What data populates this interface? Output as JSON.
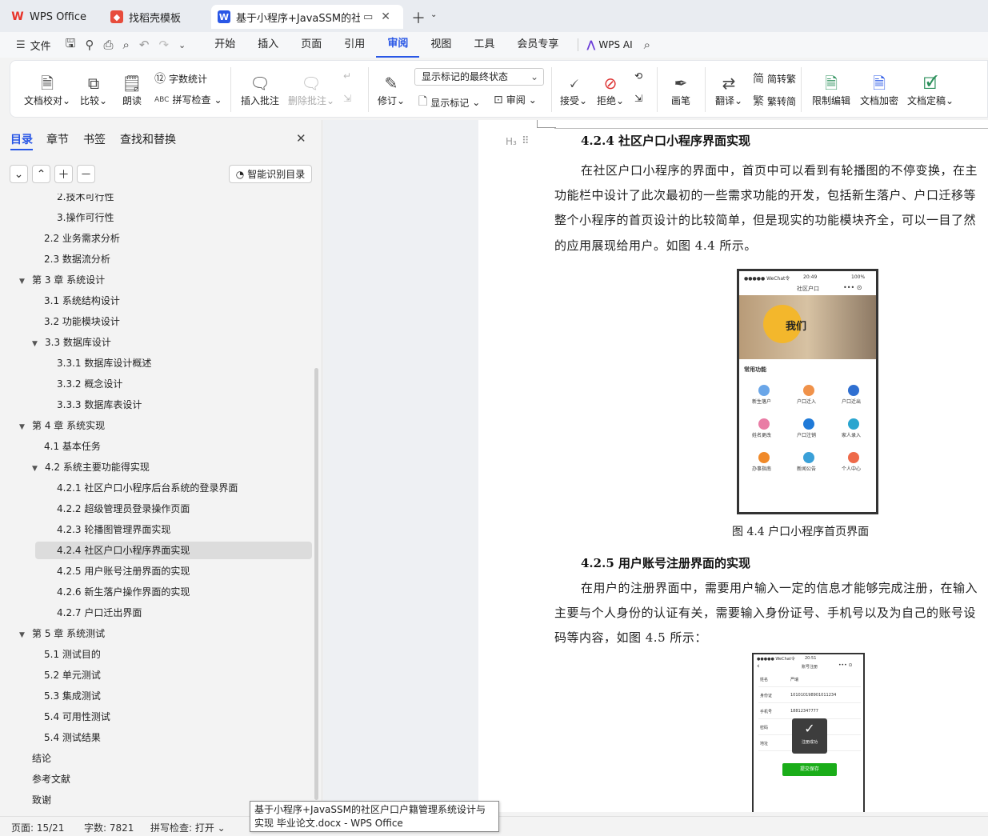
{
  "tabs": [
    {
      "label": "WPS Office",
      "icon": "wps-logo-icon"
    },
    {
      "label": "找稻壳模板",
      "icon": "docer-icon"
    },
    {
      "label": "基于小程序+JavaSSM的社区户",
      "icon": "word-doc-icon"
    }
  ],
  "menu": {
    "file": "文件",
    "items": [
      "开始",
      "插入",
      "页面",
      "引用",
      "审阅",
      "视图",
      "工具",
      "会员专享"
    ],
    "active": "审阅",
    "ai": "WPS AI"
  },
  "ribbon": {
    "doc_check": "文档校对",
    "compare": "比较",
    "read": "朗读",
    "word_count": "字数统计",
    "spell_check": "拼写检查",
    "insert_comment": "插入批注",
    "delete_comment": "删除批注",
    "revise": "修订",
    "markup_select": "显示标记的最终状态",
    "show_markup": "显示标记",
    "review": "审阅",
    "accept": "接受",
    "reject": "拒绝",
    "pen": "画笔",
    "translate": "翻译",
    "to_trad": "简转繁",
    "to_simp": "繁转简",
    "restrict": "限制编辑",
    "encrypt": "文档加密",
    "finalize": "文档定稿"
  },
  "sidebar": {
    "tabs": [
      "目录",
      "章节",
      "书签",
      "查找和替换"
    ],
    "smart_btn": "智能识别目录",
    "toc": [
      {
        "label": "2.技术可行性",
        "level": 3
      },
      {
        "label": "3.操作可行性",
        "level": 3
      },
      {
        "label": "2.2 业务需求分析",
        "level": 2
      },
      {
        "label": "2.3 数据流分析",
        "level": 2
      },
      {
        "label": "第 3 章  系统设计",
        "level": 1,
        "open": true
      },
      {
        "label": "3.1 系统结构设计",
        "level": 2
      },
      {
        "label": "3.2 功能模块设计",
        "level": 2
      },
      {
        "label": "3.3 数据库设计",
        "level": 2,
        "open": true
      },
      {
        "label": "3.3.1 数据库设计概述",
        "level": 3
      },
      {
        "label": "3.3.2 概念设计",
        "level": 3
      },
      {
        "label": "3.3.3 数据库表设计",
        "level": 3
      },
      {
        "label": "第 4 章   系统实现",
        "level": 1,
        "open": true
      },
      {
        "label": "4.1 基本任务",
        "level": 2
      },
      {
        "label": "4.2 系统主要功能得实现",
        "level": 2,
        "open": true
      },
      {
        "label": "4.2.1 社区户口小程序后台系统的登录界面",
        "level": 3
      },
      {
        "label": "4.2.2  超级管理员登录操作页面",
        "level": 3
      },
      {
        "label": "4.2.3 轮播图管理界面实现",
        "level": 3
      },
      {
        "label": "4.2.4 社区户口小程序界面实现",
        "level": 3,
        "selected": true
      },
      {
        "label": "4.2.5 用户账号注册界面的实现",
        "level": 3
      },
      {
        "label": "4.2.6 新生落户操作界面的实现",
        "level": 3
      },
      {
        "label": "4.2.7 户口迁出界面",
        "level": 3
      },
      {
        "label": "第 5 章   系统测试",
        "level": 1,
        "open": true
      },
      {
        "label": "5.1 测试目的",
        "level": 2
      },
      {
        "label": "5.2 单元测试",
        "level": 2
      },
      {
        "label": "5.3 集成测试",
        "level": 2
      },
      {
        "label": "5.4 可用性测试",
        "level": 2
      },
      {
        "label": "5.4 测试结果",
        "level": 2
      },
      {
        "label": "结论",
        "level": 1
      },
      {
        "label": "参考文献",
        "level": 1
      },
      {
        "label": "致谢",
        "level": 1
      }
    ]
  },
  "doc": {
    "heading_424": "4.2.4 社区户口小程序界面实现",
    "p1": [
      "在社区户口小程序的界面中，首页中可以看到有轮播图的不停变换，在主",
      "功能栏中设计了此次最初的一些需求功能的开发，包括新生落户、户口迁移等",
      "整个小程序的首页设计的比较简单，但是现实的功能模块齐全，可以一目了然",
      "的应用展现给用户。如图 4.4 所示。"
    ],
    "fig44_caption": "图 4.4 户口小程序首页界面",
    "heading_425": "4.2.5 用户账号注册界面的实现",
    "p2": [
      "在用户的注册界面中，需要用户输入一定的信息才能够完成注册，在输入",
      "主要与个人身份的认证有关，需要输入身份证号、手机号以及为自己的账号设",
      "码等内容，如图 4.5 所示："
    ],
    "phone1": {
      "carrier": "●●●●● WeChat令",
      "time": "20:49",
      "battery": "100%",
      "title": "社区户口",
      "banner": "我们",
      "section": "常用功能",
      "funcs": [
        "新生落户",
        "户口迁入",
        "户口迁出",
        "姓名更改",
        "户口注销",
        "家人录入",
        "办事指南",
        "新闻公告",
        "个人中心"
      ]
    },
    "phone2": {
      "carrier": "●●●●● WeChat令",
      "time": "20:51",
      "title": "账号注册",
      "fields": [
        [
          "姓名",
          "严瑞"
        ],
        [
          "身份证",
          "101010198901011234"
        ],
        [
          "手机号",
          "18812347777"
        ],
        [
          "密码",
          ""
        ],
        [
          "地址",
          ""
        ]
      ],
      "toast": "注册成功",
      "submit": "提交保存"
    }
  },
  "status": {
    "page": "页面: 15/21",
    "words": "字数: 7821",
    "spell": "拼写检查: 打开"
  },
  "tooltip": "基于小程序+JavaSSM的社区户口户籍管理系统设计与实现 毕业论文.docx - WPS Office",
  "colors": {
    "accent": "#2957e6",
    "wps_red": "#e8332a",
    "docer": "#e74c3c"
  }
}
